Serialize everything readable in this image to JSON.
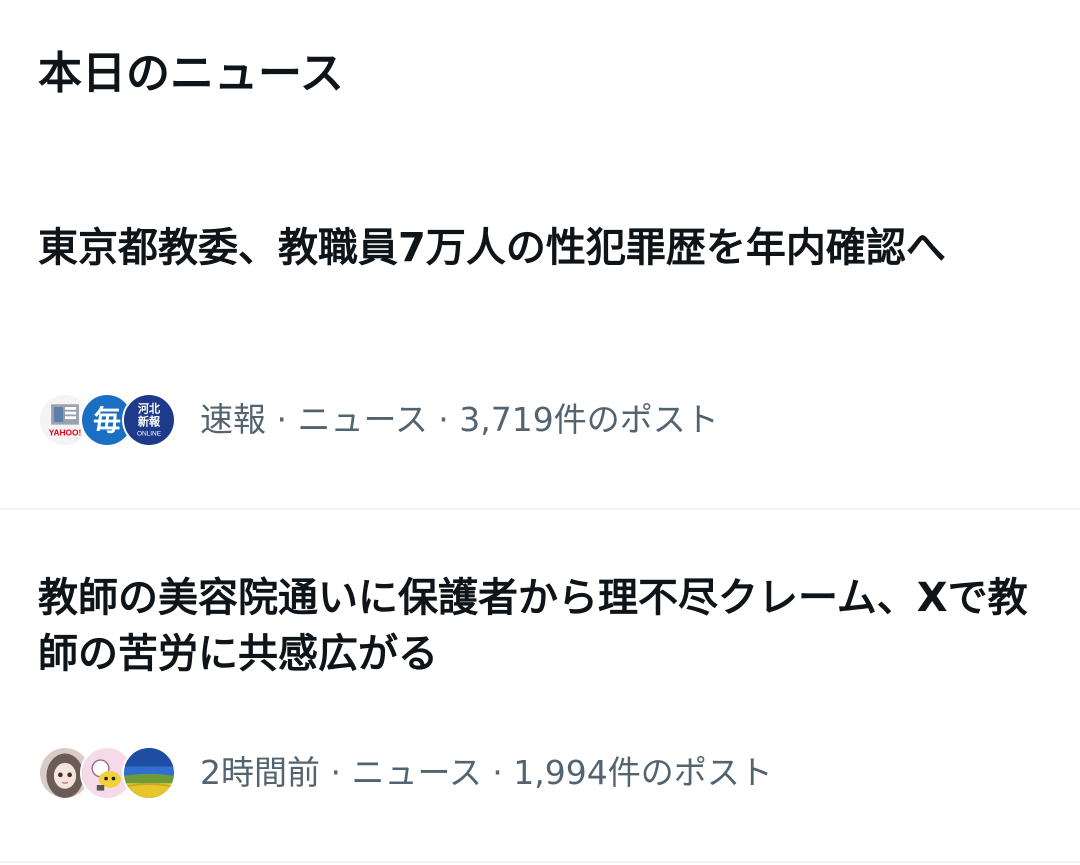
{
  "section": {
    "title": "本日のニュース"
  },
  "news": [
    {
      "headline": "東京都教委、教職員7万人の性犯罪歴を年内確認へ",
      "meta": "速報 · ニュース · 3,719件のポスト",
      "avatars": [
        "yahoo-news-logo",
        "mainichi-logo",
        "kahoku-shimpo-online-logo"
      ],
      "avatar_texts": {
        "yahoo": "YAHOO!",
        "mainichi": "毎",
        "kahoku_line1": "河北",
        "kahoku_line2": "新報",
        "kahoku_line3": "ONLINE"
      }
    },
    {
      "headline": "教師の美容院通いに保護者から理不尽クレーム、Xで教師の苦労に共感広がる",
      "meta": "2時間前 · ニュース · 1,994件のポスト",
      "avatars": [
        "anime-girl-avatar",
        "cartoon-character-avatar",
        "landscape-avatar"
      ]
    }
  ],
  "colors": {
    "text_primary": "#0f1419",
    "text_secondary": "#536471",
    "divider": "#eff3f4",
    "mainichi_blue": "#1a6fc4",
    "kahoku_navy": "#1e3a8a",
    "yahoo_red": "#e60012"
  }
}
